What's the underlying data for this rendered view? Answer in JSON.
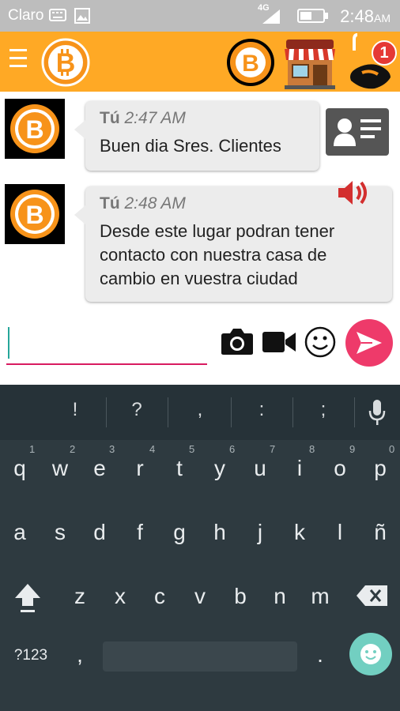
{
  "status_bar": {
    "carrier": "Claro",
    "network": "4G",
    "time": "2:48",
    "ampm": "AM"
  },
  "app_bar": {
    "notification_count": "1",
    "colors": {
      "bar": "#ffa925",
      "badge": "#e53935"
    }
  },
  "messages": [
    {
      "sender": "Tú",
      "time": "2:47 AM",
      "lines": [
        "Buen dia Sres. Clientes"
      ]
    },
    {
      "sender": "Tú",
      "time": "2:48 AM",
      "lines": [
        "Desde este lugar podran tener",
        "contacto con nuestra casa de",
        "cambio en vuestra ciudad"
      ]
    }
  ],
  "composer": {
    "value": "",
    "icons": [
      "camera-icon",
      "video-camera-icon",
      "smiley-icon",
      "send-icon"
    ],
    "send_color": "#ee3a6a"
  },
  "keyboard": {
    "suggestions": [
      "!",
      "?",
      ",",
      ":",
      ";"
    ],
    "row1": [
      "q",
      "w",
      "e",
      "r",
      "t",
      "y",
      "u",
      "i",
      "o",
      "p"
    ],
    "row1_hints": [
      "1",
      "2",
      "3",
      "4",
      "5",
      "6",
      "7",
      "8",
      "9",
      "0"
    ],
    "row2": [
      "a",
      "s",
      "d",
      "f",
      "g",
      "h",
      "j",
      "k",
      "l",
      "ñ"
    ],
    "row3": [
      "z",
      "x",
      "c",
      "v",
      "b",
      "n",
      "m"
    ],
    "symbols_key": "?123",
    "comma_key": ",",
    "period_key": "."
  }
}
